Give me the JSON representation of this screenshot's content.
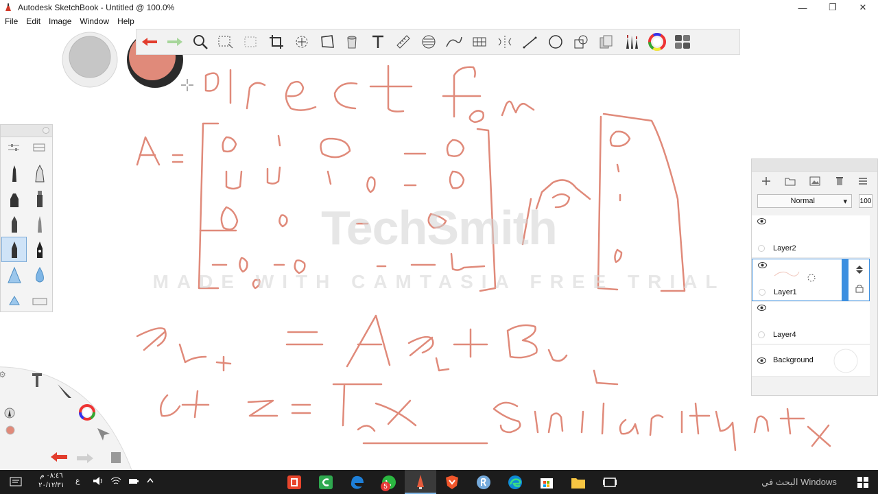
{
  "window": {
    "title": "Autodesk SketchBook - Untitled @ 100.0%"
  },
  "menu": {
    "file": "File",
    "edit": "Edit",
    "image": "Image",
    "window": "Window",
    "help": "Help"
  },
  "layers": {
    "blend_mode": "Normal",
    "opacity": "100",
    "items": [
      {
        "name": "Layer2"
      },
      {
        "name": "Layer1"
      },
      {
        "name": "Layer4"
      },
      {
        "name": "Background"
      }
    ]
  },
  "watermark": {
    "brand": "TechSmith",
    "line": "MADE WITH CAMTASIA FREE TRIAL"
  },
  "taskbar": {
    "search_text": "البحث في Windows",
    "time": "٠٨:٤٦ م",
    "date": "٢٠/١٢/٣١",
    "lang": "ع",
    "badge": "5"
  },
  "colors": {
    "stroke": "#e08a7a",
    "selected_layer": "#3c8fe0",
    "taskbar": "#1c1c1c"
  }
}
